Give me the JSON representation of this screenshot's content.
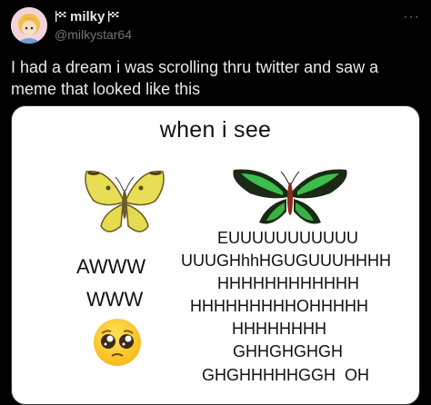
{
  "tweet": {
    "display_name": "milky",
    "handle": "@milkystar64",
    "text": "I had a dream i was scrolling thru twitter and saw a meme that looked like this",
    "more_label": "···"
  },
  "meme": {
    "title": "when i see",
    "left_text": [
      "AWWW",
      "WWW"
    ],
    "right_text": [
      "EUUUUUUUUUUU",
      "UUUGHhhHGUGUUUHHHH",
      "HHHHHHHHHHHH",
      "HHHHHHHHHOHHHHH",
      "HHHHHHHH",
      "GHHGHGHGH",
      "GHGHHHHHGGH  OH"
    ]
  },
  "icons": {
    "flag_left": "checkered-flag-icon",
    "flag_right": "checkered-flag-icon",
    "more": "more-options-icon",
    "yellow_butterfly": "yellow-butterfly-icon",
    "green_butterfly": "green-butterfly-icon",
    "pleading_emoji": "pleading-face-icon"
  },
  "colors": {
    "background": "#000000",
    "text_primary": "#e7e9ea",
    "text_secondary": "#71767b",
    "media_background": "#ffffff"
  }
}
